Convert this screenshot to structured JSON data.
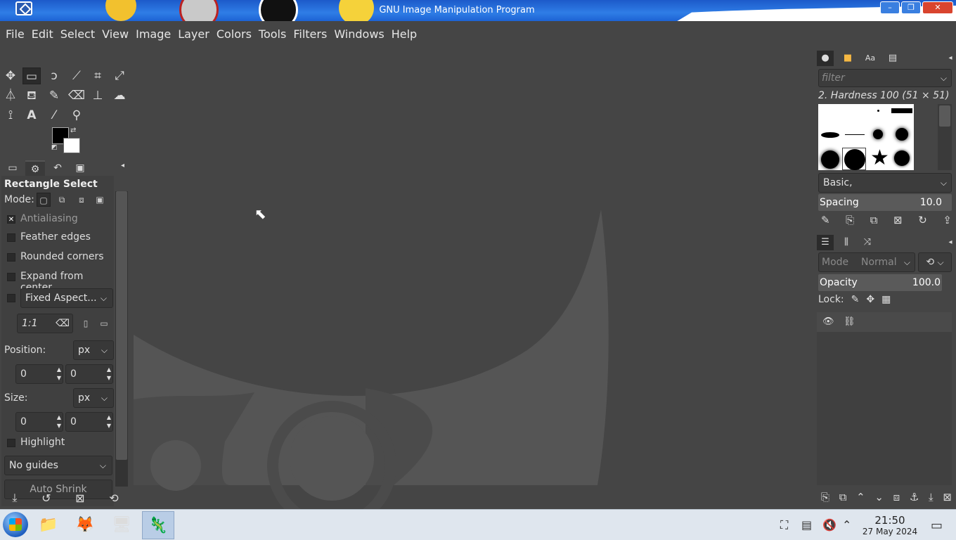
{
  "window": {
    "title": "GNU Image Manipulation Program",
    "controls": [
      "–",
      "❐",
      "✕"
    ]
  },
  "menubar": [
    "File",
    "Edit",
    "Select",
    "View",
    "Image",
    "Layer",
    "Colors",
    "Tools",
    "Filters",
    "Windows",
    "Help"
  ],
  "colors": {
    "foreground": "#000000",
    "background": "#ffffff",
    "ui_bg": "#454545",
    "titlebar": "#2f7de6"
  },
  "tool_options": {
    "title": "Rectangle Select",
    "mode_label": "Mode:",
    "antialiasing": {
      "label": "Antialiasing",
      "checked": true
    },
    "feather_edges": {
      "label": "Feather edges",
      "checked": false
    },
    "rounded_corners": {
      "label": "Rounded corners",
      "checked": false
    },
    "expand_from_center": {
      "label": "Expand from center",
      "checked": false
    },
    "fixed": {
      "checked": false,
      "value": "Fixed Aspect...",
      "ratio": "1:1"
    },
    "position_label": "Position:",
    "position_unit": "px",
    "position_x": "0",
    "position_y": "0",
    "size_label": "Size:",
    "size_unit": "px",
    "size_w": "0",
    "size_h": "0",
    "highlight": {
      "label": "Highlight",
      "checked": false
    },
    "guides": "No guides",
    "cut_off_text": "Auto Shrink"
  },
  "brushes": {
    "filter_placeholder": "filter",
    "selected_name": "2. Hardness 100 (51 × 51)",
    "preset": "Basic,",
    "spacing_label": "Spacing",
    "spacing_value": "10.0"
  },
  "layers": {
    "mode_label": "Mode",
    "mode_value": "Normal",
    "opacity_label": "Opacity",
    "opacity_value": "100.0",
    "lock_label": "Lock:"
  },
  "taskbar": {
    "time": "21:50",
    "date": "27 May 2024",
    "apps": [
      "start",
      "file-explorer",
      "firefox",
      "remote-desktop",
      "gimp"
    ]
  }
}
